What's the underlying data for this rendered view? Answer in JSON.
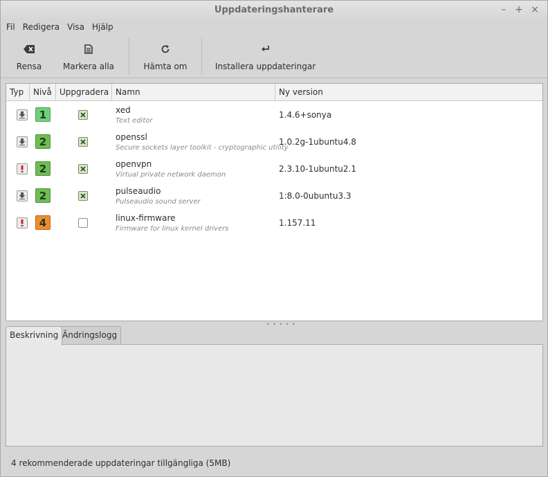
{
  "window": {
    "title": "Uppdateringshanterare",
    "controls": {
      "minimize": "–",
      "maximize": "+",
      "close": "×"
    }
  },
  "menubar": {
    "items": [
      "Fil",
      "Redigera",
      "Visa",
      "Hjälp"
    ]
  },
  "toolbar": {
    "clear_label": "Rensa",
    "select_all_label": "Markera alla",
    "refresh_label": "Hämta om",
    "install_label": "Installera uppdateringar"
  },
  "table": {
    "columns": [
      "Typ",
      "Nivå",
      "Uppgradera",
      "Namn",
      "Ny version"
    ],
    "rows": [
      {
        "type": "package",
        "level": "1",
        "level_color": "#6fcf7a",
        "checked": true,
        "name": "xed",
        "description": "Text editor",
        "version": "1.4.6+sonya"
      },
      {
        "type": "package",
        "level": "2",
        "level_color": "#6ebd52",
        "checked": true,
        "name": "openssl",
        "description": "Secure sockets layer toolkit - cryptographic utility",
        "version": "1.0.2g-1ubuntu4.8"
      },
      {
        "type": "security",
        "level": "2",
        "level_color": "#6ebd52",
        "checked": true,
        "name": "openvpn",
        "description": "Virtual private network daemon",
        "version": "2.3.10-1ubuntu2.1"
      },
      {
        "type": "package",
        "level": "2",
        "level_color": "#6ebd52",
        "checked": true,
        "name": "pulseaudio",
        "description": "Pulseaudio sound server",
        "version": "1:8.0-0ubuntu3.3"
      },
      {
        "type": "security",
        "level": "4",
        "level_color": "#f08a30",
        "checked": false,
        "name": "linux-firmware",
        "description": "Firmware for linux kernel drivers",
        "version": "1.157.11"
      }
    ]
  },
  "tabs": {
    "description_label": "Beskrivning",
    "changelog_label": "Ändringslogg"
  },
  "status": {
    "text": "4 rekommenderade uppdateringar tillgängliga (5MB)"
  }
}
